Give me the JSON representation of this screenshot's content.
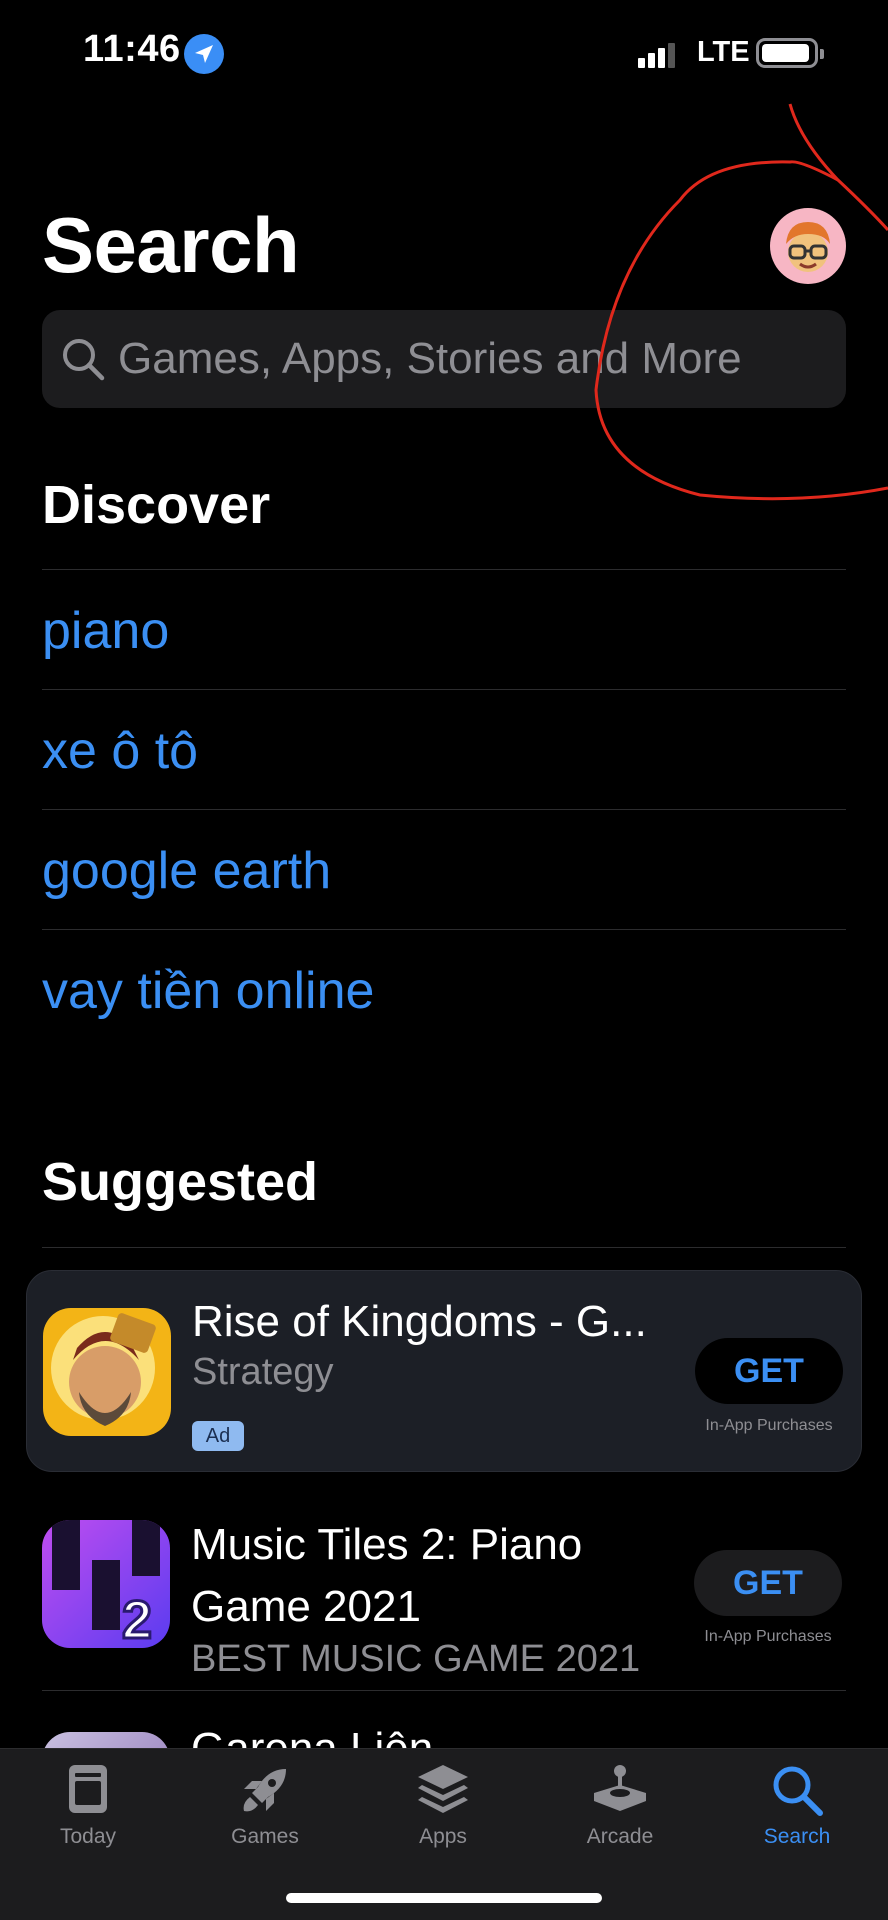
{
  "status_bar": {
    "time": "11:46",
    "network": "LTE",
    "location_icon": "location-arrow-icon",
    "signal_icon": "cellular-signal-icon",
    "battery_icon": "battery-icon"
  },
  "header": {
    "title": "Search",
    "avatar_icon": "memoji-avatar-icon"
  },
  "search": {
    "placeholder": "Games, Apps, Stories and More",
    "icon": "search-icon"
  },
  "discover": {
    "title": "Discover",
    "items": [
      "piano",
      "xe ô tô",
      "google earth",
      "vay tiền online"
    ]
  },
  "suggested": {
    "title": "Suggested",
    "apps": [
      {
        "name": "Rise of Kingdoms - G...",
        "subtitle": "Strategy",
        "badge": "Ad",
        "button": "GET",
        "note": "In-App Purchases"
      },
      {
        "name": "Music Tiles 2: Piano Game 2021",
        "subtitle": "BEST MUSIC GAME 2021",
        "button": "GET",
        "note": "In-App Purchases"
      },
      {
        "name": "Garena Liên"
      }
    ]
  },
  "tab_bar": {
    "tabs": [
      {
        "label": "Today",
        "icon": "today-icon"
      },
      {
        "label": "Games",
        "icon": "rocket-icon"
      },
      {
        "label": "Apps",
        "icon": "apps-stack-icon"
      },
      {
        "label": "Arcade",
        "icon": "joystick-icon"
      },
      {
        "label": "Search",
        "icon": "search-icon",
        "active": true
      }
    ]
  },
  "colors": {
    "accent": "#3b8ff3",
    "background": "#000000",
    "annotation": "#e0281c"
  }
}
